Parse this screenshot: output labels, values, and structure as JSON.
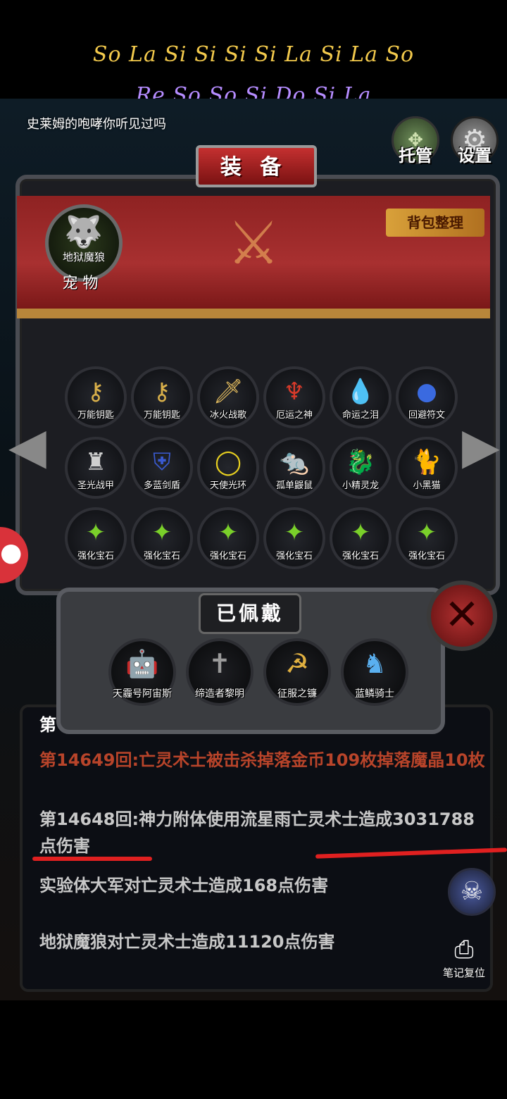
{
  "notation": {
    "line1": "So La Si Si Si Si La Si La So",
    "line2": "Re So So Si Do Si La"
  },
  "chat_message": "史莱姆的咆哮你听见过吗",
  "top_buttons": {
    "auto": "托管",
    "settings": "设置"
  },
  "equipment_panel": {
    "title": "装 备",
    "sort_button": "背包整理",
    "pet": {
      "name": "地狱魔狼",
      "label": "宠 物"
    },
    "items": [
      {
        "name": "万能钥匙",
        "icon": "key-icon"
      },
      {
        "name": "万能钥匙",
        "icon": "key-icon"
      },
      {
        "name": "冰火战歌",
        "icon": "sword-icon"
      },
      {
        "name": "厄运之神",
        "icon": "demon-icon"
      },
      {
        "name": "命运之泪",
        "icon": "tear-icon"
      },
      {
        "name": "回避符文",
        "icon": "rune-orb-icon"
      },
      {
        "name": "圣光战甲",
        "icon": "armor-icon"
      },
      {
        "name": "多蓝剑盾",
        "icon": "shield-icon"
      },
      {
        "name": "天使光环",
        "icon": "halo-icon"
      },
      {
        "name": "孤单鼹鼠",
        "icon": "mole-icon"
      },
      {
        "name": "小精灵龙",
        "icon": "dragon-icon"
      },
      {
        "name": "小黑猫",
        "icon": "cat-icon"
      },
      {
        "name": "强化宝石",
        "icon": "gem-icon"
      },
      {
        "name": "强化宝石",
        "icon": "gem-icon"
      },
      {
        "name": "强化宝石",
        "icon": "gem-icon"
      },
      {
        "name": "强化宝石",
        "icon": "gem-icon"
      },
      {
        "name": "强化宝石",
        "icon": "gem-icon"
      },
      {
        "name": "强化宝石",
        "icon": "gem-icon"
      }
    ]
  },
  "worn_panel": {
    "title": "已佩戴",
    "items": [
      {
        "name": "天霾号阿宙斯",
        "icon": "mech-icon"
      },
      {
        "name": "缔造者黎明",
        "icon": "greatsword-icon"
      },
      {
        "name": "征服之镰",
        "icon": "scythe-icon"
      },
      {
        "name": "蓝鳞骑士",
        "icon": "knight-icon"
      }
    ]
  },
  "battle_log": {
    "cut_line": "第",
    "red_line": "第14649回:亡灵术士被击杀掉落金币109枚掉落魔晶10枚",
    "gray_line": "第14648回:神力附体使用流星雨亡灵术士造成3031788点伤害",
    "line3": "实验体大军对亡灵术士造成168点伤害",
    "line4": "地狱魔狼对亡灵术士造成11120点伤害"
  },
  "note_reset_label": "笔记复位",
  "colors": {
    "banner_red": "#a83030",
    "log_red": "#b8442a",
    "underline_red": "#e02020",
    "note1": "#f2c94c",
    "note2": "#b58cff"
  }
}
